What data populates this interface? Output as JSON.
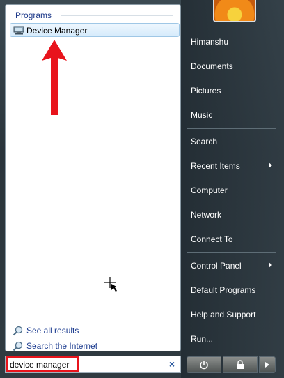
{
  "left_pane": {
    "programs_header": "Programs",
    "result_item": "Device Manager",
    "see_all_results": "See all results",
    "search_internet": "Search the Internet"
  },
  "search": {
    "value": "device manager",
    "clear_symbol": "×"
  },
  "right_menu": {
    "user": "Himanshu",
    "items": [
      "Documents",
      "Pictures",
      "Music"
    ],
    "group2": [
      "Search",
      "Recent Items",
      "Computer",
      "Network",
      "Connect To"
    ],
    "group3": [
      "Control Panel",
      "Default Programs",
      "Help and Support",
      "Run..."
    ]
  },
  "colors": {
    "annotation_red": "#e8141c",
    "link_blue": "#1b3b8f",
    "header_blue": "#1e3a8a"
  },
  "icons": [
    "device-manager-icon",
    "magnifier-icon",
    "power-icon",
    "lock-icon",
    "arrow-right-icon",
    "user-picture-icon"
  ]
}
